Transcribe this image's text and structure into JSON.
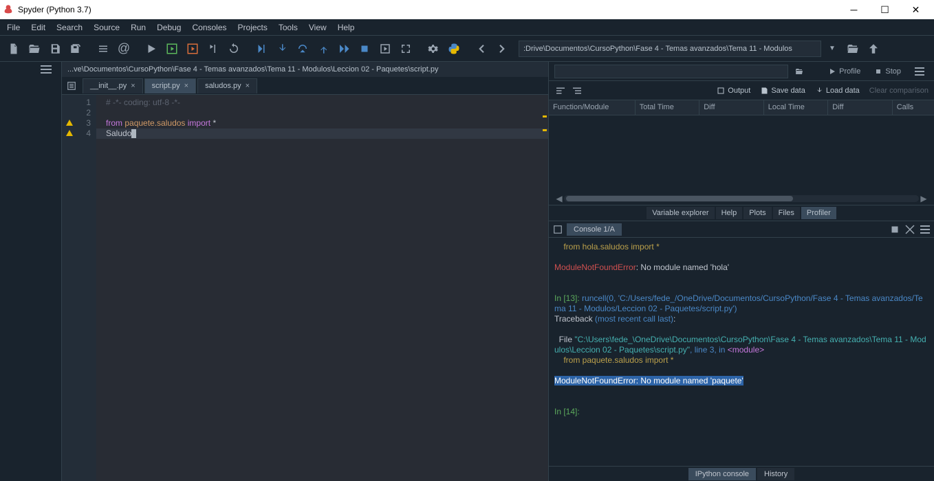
{
  "window": {
    "title": "Spyder (Python 3.7)"
  },
  "menu": {
    "items": [
      "File",
      "Edit",
      "Search",
      "Source",
      "Run",
      "Debug",
      "Consoles",
      "Projects",
      "Tools",
      "View",
      "Help"
    ]
  },
  "toolbar": {
    "cwd": ":Drive\\Documentos\\CursoPython\\Fase 4 - Temas avanzados\\Tema 11 - Modulos"
  },
  "editor": {
    "path": "...ve\\Documentos\\CursoPython\\Fase 4 - Temas avanzados\\Tema 11 - Modulos\\Leccion 02 - Paquetes\\script.py",
    "tabs": [
      {
        "label": "__init__.py",
        "active": false
      },
      {
        "label": "script.py",
        "active": true
      },
      {
        "label": "saludos.py",
        "active": false
      }
    ],
    "lines": [
      {
        "n": "1",
        "type": "comment",
        "text": "# -*- coding: utf-8 -*-"
      },
      {
        "n": "2",
        "type": "blank",
        "text": ""
      },
      {
        "n": "3",
        "type": "import",
        "warn": true,
        "from": "from",
        "mod": "paquete.saludos",
        "imp": "import",
        "rest": " *"
      },
      {
        "n": "4",
        "type": "cursor",
        "warn": true,
        "text": "Saludo"
      }
    ]
  },
  "profiler": {
    "run_label": "Profile",
    "stop_label": "Stop",
    "output": "Output",
    "save": "Save data",
    "load": "Load data",
    "clear": "Clear comparison",
    "columns": [
      "Function/Module",
      "Total Time",
      "Diff",
      "Local Time",
      "Diff",
      "Calls"
    ]
  },
  "pane_tabs": [
    "Variable explorer",
    "Help",
    "Plots",
    "Files",
    "Profiler"
  ],
  "pane_tab_active": 4,
  "console": {
    "tab": "Console 1/A",
    "lines": {
      "import_hola": "    from hola.saludos import *",
      "err_hola_label": "ModuleNotFoundError",
      "err_hola_msg": ": No module named 'hola'",
      "prompt_in13": "In [13]:",
      "runcell": " runcell(0, 'C:/Users/fede_/OneDrive/Documentos/CursoPython/Fase 4 - Temas avanzados/Tema 11 - Modulos/Leccion 02 - Paquetes/script.py')",
      "traceback": "Traceback ",
      "traceback_paren": "(most recent call last)",
      "traceback_colon": ":",
      "file_word": "  File ",
      "file_path": "\"C:\\Users\\fede_\\OneDrive\\Documentos\\CursoPython\\Fase 4 - Temas avanzados\\Tema 11 - Modulos\\Leccion 02 - Paquetes\\script.py\"",
      "file_rest": ", line 3, in ",
      "module_tag": "<module>",
      "import_paq": "    from paquete.saludos import *",
      "err_paq_label": "ModuleNotFoundError",
      "err_paq_msg": ": No module named 'paquete'",
      "prompt_in14": "In [14]:"
    },
    "bottom_tabs": [
      "IPython console",
      "History"
    ]
  }
}
